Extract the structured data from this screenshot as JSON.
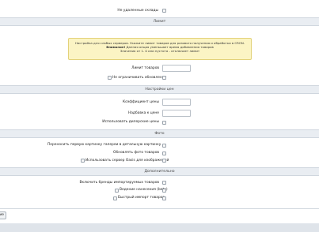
{
  "top_row": {
    "label": "Не удаленные склады"
  },
  "sections": {
    "limit": {
      "title": "Лимит",
      "notice": {
        "line1": "Настройка для слабых серверов. Укажите лимит товаров для разового получения и обработки в CRON.",
        "line2_bold": "Внимание!",
        "line2": " Данная опция уменьшает время добавления товаров",
        "line3": "Значения от 1. 0 или пустота - отключает лимит"
      },
      "fields": {
        "limit_label": "Лимит товаров",
        "limit_value": "",
        "no_limit_updates_label": "Не ограничивать обновление"
      }
    },
    "prices": {
      "title": "Настройки цен",
      "fields": {
        "coef_label": "Коэффициент цены",
        "coef_value": "",
        "markup_label": "Надбавка к цене",
        "markup_value": "",
        "dealer_prices_label": "Использовать дилерские цены"
      }
    },
    "photo": {
      "title": "Фото",
      "fields": {
        "move_first_label": "Переносить первую картинку галереи в детальную картинку",
        "refresh_photos_label": "Обновлять фото товаров",
        "oasis_server_label": "Использовать сервер Oasis для изображений"
      }
    },
    "extra": {
      "title": "Дополнительно",
      "fields": {
        "brands_label": "Включить бренды импортируемых товаров",
        "logging_label": "Ведение нанесения (beta)",
        "fast_import_label": "Быстрый импорт товаров"
      }
    }
  },
  "footer": {
    "save_label": "ние"
  }
}
